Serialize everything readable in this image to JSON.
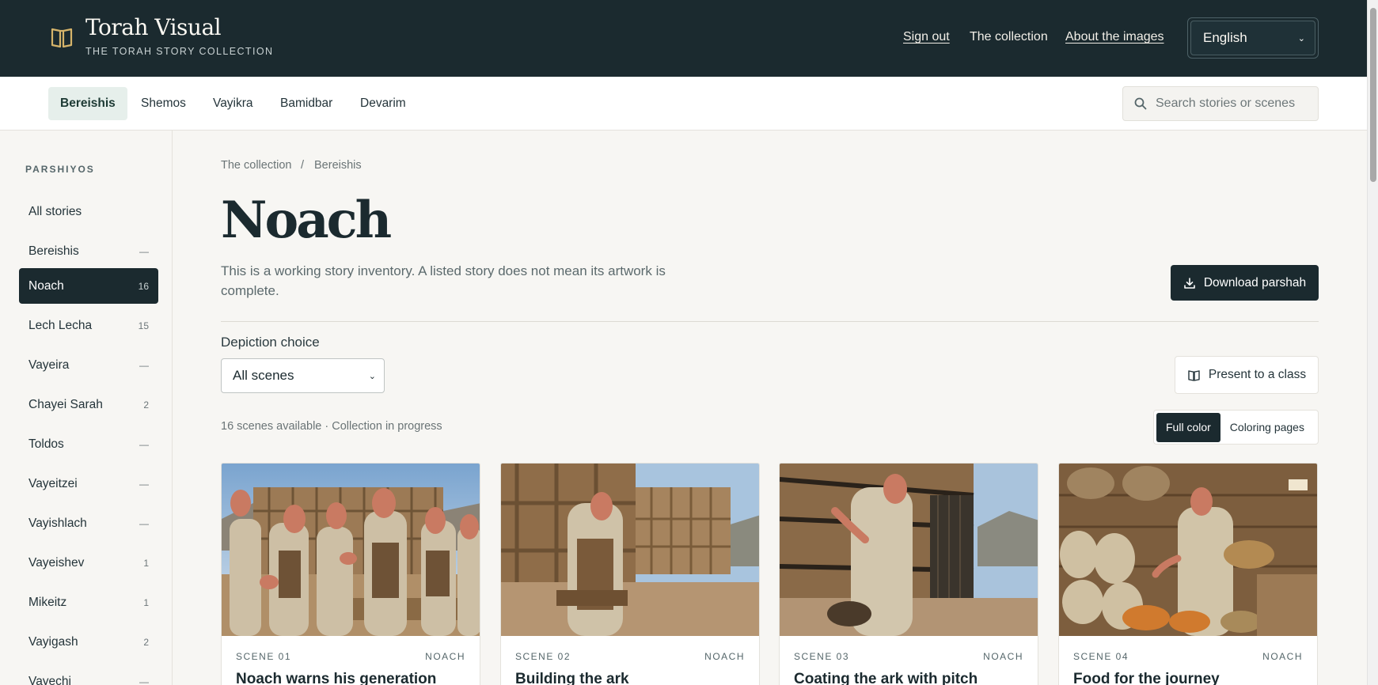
{
  "header": {
    "title": "Torah Visual",
    "subtitle": "THE TORAH STORY COLLECTION",
    "nav": {
      "sign_out": "Sign out",
      "collection": "The collection",
      "about": "About the images"
    },
    "language": "English"
  },
  "books": {
    "tabs": [
      {
        "label": "Bereishis",
        "active": true
      },
      {
        "label": "Shemos"
      },
      {
        "label": "Vayikra"
      },
      {
        "label": "Bamidbar"
      },
      {
        "label": "Devarim"
      }
    ],
    "search_placeholder": "Search stories or scenes"
  },
  "sidebar": {
    "heading": "PARSHIYOS",
    "items": [
      {
        "label": "All stories",
        "count": ""
      },
      {
        "label": "Bereishis",
        "count": "—"
      },
      {
        "label": "Noach",
        "count": "16",
        "active": true
      },
      {
        "label": "Lech Lecha",
        "count": "15"
      },
      {
        "label": "Vayeira",
        "count": "—"
      },
      {
        "label": "Chayei Sarah",
        "count": "2"
      },
      {
        "label": "Toldos",
        "count": "—"
      },
      {
        "label": "Vayeitzei",
        "count": "—"
      },
      {
        "label": "Vayishlach",
        "count": "—"
      },
      {
        "label": "Vayeishev",
        "count": "1"
      },
      {
        "label": "Mikeitz",
        "count": "1"
      },
      {
        "label": "Vayigash",
        "count": "2"
      },
      {
        "label": "Vayechi",
        "count": "—"
      }
    ]
  },
  "main": {
    "breadcrumb": {
      "root": "The collection",
      "separator": "/",
      "current": "Bereishis"
    },
    "title": "Noach",
    "description": "This is a working story inventory. A listed story does not mean its artwork is complete.",
    "download_label": "Download parshah",
    "depiction_label": "Depiction choice",
    "depiction_value": "All scenes",
    "present_label": "Present to a class",
    "status": "16 scenes available · Collection in progress",
    "view_toggle": {
      "full_color": "Full color",
      "coloring": "Coloring pages",
      "selected": "Full color"
    }
  },
  "cards": [
    {
      "scene": "SCENE 01",
      "parsha": "NOACH",
      "title": "Noach warns his generation"
    },
    {
      "scene": "SCENE 02",
      "parsha": "NOACH",
      "title": "Building the ark"
    },
    {
      "scene": "SCENE 03",
      "parsha": "NOACH",
      "title": "Coating the ark with pitch"
    },
    {
      "scene": "SCENE 04",
      "parsha": "NOACH",
      "title": "Food for the journey"
    }
  ],
  "colors": {
    "primary": "#1b2a2f",
    "accent_tab": "#e6efeb",
    "background": "#f7f6f3",
    "face_mask": "#c97a62",
    "brand_icon": "#d6b46a"
  }
}
